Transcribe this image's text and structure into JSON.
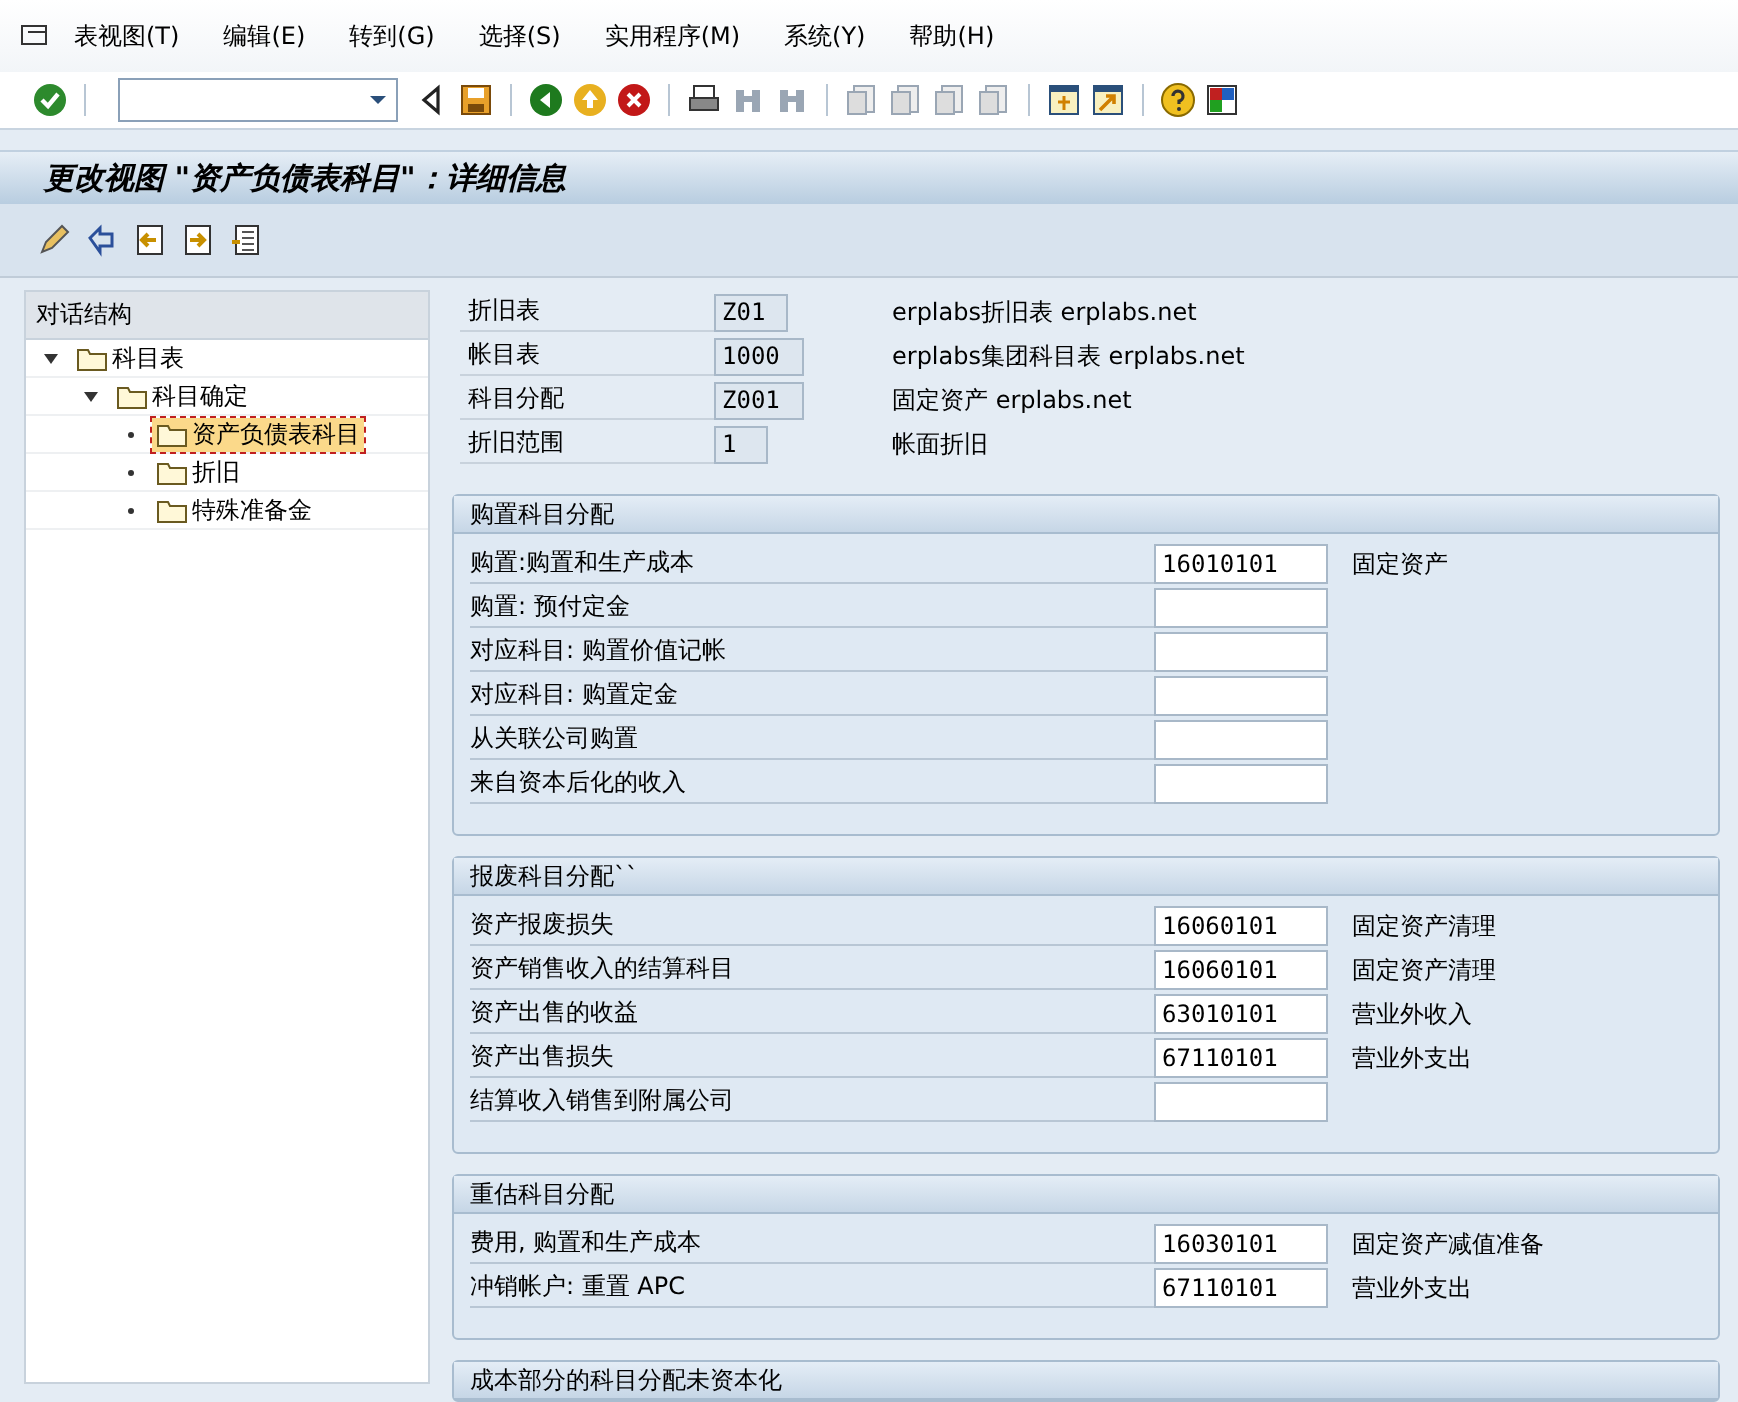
{
  "menu": [
    {
      "label": "表视图(T)"
    },
    {
      "label": "编辑(E)"
    },
    {
      "label": "转到(G)"
    },
    {
      "label": "选择(S)"
    },
    {
      "label": "实用程序(M)"
    },
    {
      "label": "系统(Y)"
    },
    {
      "label": "帮助(H)"
    }
  ],
  "title": "更改视图 \"资产负债表科目\"：详细信息",
  "tree": {
    "header": "对话结构",
    "items": [
      {
        "label": "科目表",
        "expanded": true,
        "selected": false,
        "children": [
          {
            "label": "科目确定",
            "expanded": true,
            "selected": false,
            "children": [
              {
                "label": "资产负债表科目",
                "selected": true
              },
              {
                "label": "折旧",
                "selected": false
              },
              {
                "label": "特殊准备金",
                "selected": false
              }
            ]
          }
        ]
      }
    ]
  },
  "header_fields": [
    {
      "label": "折旧表",
      "value": "Z01",
      "description": "erplabs折旧表 erplabs.net"
    },
    {
      "label": "帐目表",
      "value": "1000",
      "description": "erplabs集团科目表 erplabs.net"
    },
    {
      "label": "科目分配",
      "value": "Z001",
      "description": "固定资产 erplabs.net"
    },
    {
      "label": "折旧范围",
      "value": "1",
      "description": "帐面折旧"
    }
  ],
  "groups": [
    {
      "title": "购置科目分配",
      "rows": [
        {
          "label": "购置:购置和生产成本",
          "value": "16010101",
          "description": "固定资产"
        },
        {
          "label": "购置: 预付定金"
        },
        {
          "label": "对应科目: 购置价值记帐"
        },
        {
          "label": "对应科目: 购置定金"
        },
        {
          "label": "从关联公司购置"
        },
        {
          "label": "来自资本后化的收入"
        }
      ]
    },
    {
      "title": "报废科目分配``",
      "rows": [
        {
          "label": "资产报废损失",
          "value": "16060101",
          "description": "固定资产清理"
        },
        {
          "label": "资产销售收入的结算科目",
          "value": "16060101",
          "description": "固定资产清理"
        },
        {
          "label": "资产出售的收益",
          "value": "63010101",
          "description": "营业外收入"
        },
        {
          "label": "资产出售损失",
          "value": "67110101",
          "description": "营业外支出"
        },
        {
          "label": "结算收入销售到附属公司"
        }
      ]
    },
    {
      "title": "重估科目分配",
      "rows": [
        {
          "label": "费用, 购置和生产成本",
          "value": "16030101",
          "description": "固定资产减值准备"
        },
        {
          "label": "冲销帐户: 重置 APC",
          "value": "67110101",
          "description": "营业外支出"
        }
      ]
    },
    {
      "title": "成本部分的科目分配未资本化"
    }
  ]
}
